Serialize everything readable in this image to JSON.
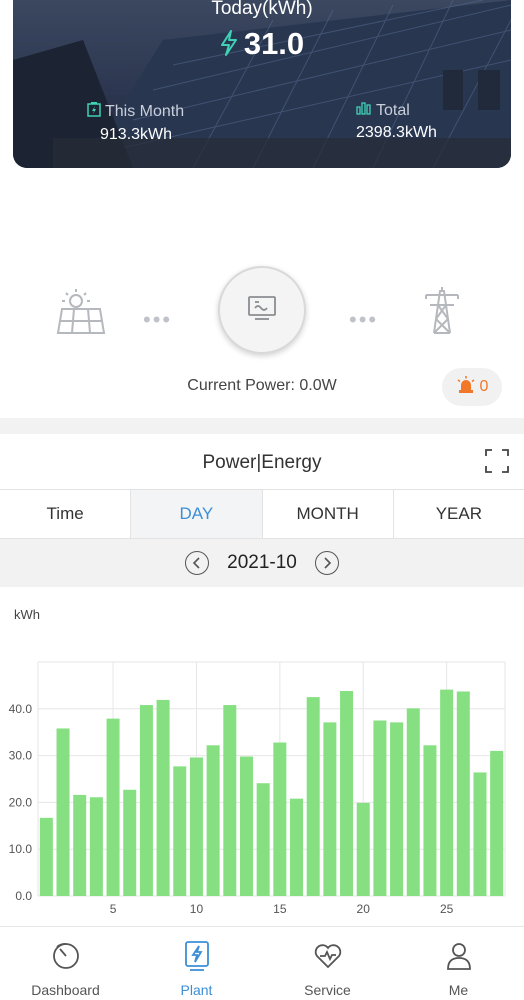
{
  "hero": {
    "today_label": "Today(kWh)",
    "today_value": "31.0",
    "this_month_label": "This Month",
    "this_month_value": "913.3kWh",
    "total_label": "Total",
    "total_value": "2398.3kWh"
  },
  "flow": {
    "current_power_label": "Current Power:",
    "current_power_value": "0.0W",
    "alarm_count": "0",
    "icons": [
      "solar-panel-icon",
      "inverter-icon",
      "power-tower-icon"
    ]
  },
  "chart_card": {
    "title": "Power|Energy",
    "tabs": [
      "Time",
      "DAY",
      "MONTH",
      "YEAR"
    ],
    "active_tab": "DAY",
    "period": "2021-10"
  },
  "chart_data": {
    "type": "bar",
    "ylabel": "kWh",
    "ylim": [
      0,
      50
    ],
    "yticks": [
      "0.0",
      "10.0",
      "20.0",
      "30.0",
      "40.0"
    ],
    "xticks": [
      5,
      10,
      15,
      20,
      25
    ],
    "x": [
      1,
      2,
      3,
      4,
      5,
      6,
      7,
      8,
      9,
      10,
      11,
      12,
      13,
      14,
      15,
      16,
      17,
      18,
      19,
      20,
      21,
      22,
      23,
      24,
      25,
      26,
      27,
      28
    ],
    "values": [
      16.7,
      35.8,
      21.6,
      21.1,
      37.9,
      22.7,
      40.8,
      41.9,
      27.7,
      29.6,
      32.2,
      40.8,
      29.8,
      24.1,
      32.8,
      20.8,
      42.5,
      37.1,
      43.8,
      19.9,
      37.5,
      37.1,
      40.1,
      32.2,
      44.1,
      43.7,
      26.4,
      31.0
    ],
    "grid": true,
    "bar_color": "#86e082"
  },
  "nav": {
    "items": [
      {
        "label": "Dashboard",
        "icon": "dashboard-icon"
      },
      {
        "label": "Plant",
        "icon": "plant-icon"
      },
      {
        "label": "Service",
        "icon": "service-icon"
      },
      {
        "label": "Me",
        "icon": "user-icon"
      }
    ],
    "active": "Plant"
  },
  "colors": {
    "accent": "#3c8ed6",
    "alarm": "#f07828",
    "hero_icon": "#3fd2b5"
  }
}
